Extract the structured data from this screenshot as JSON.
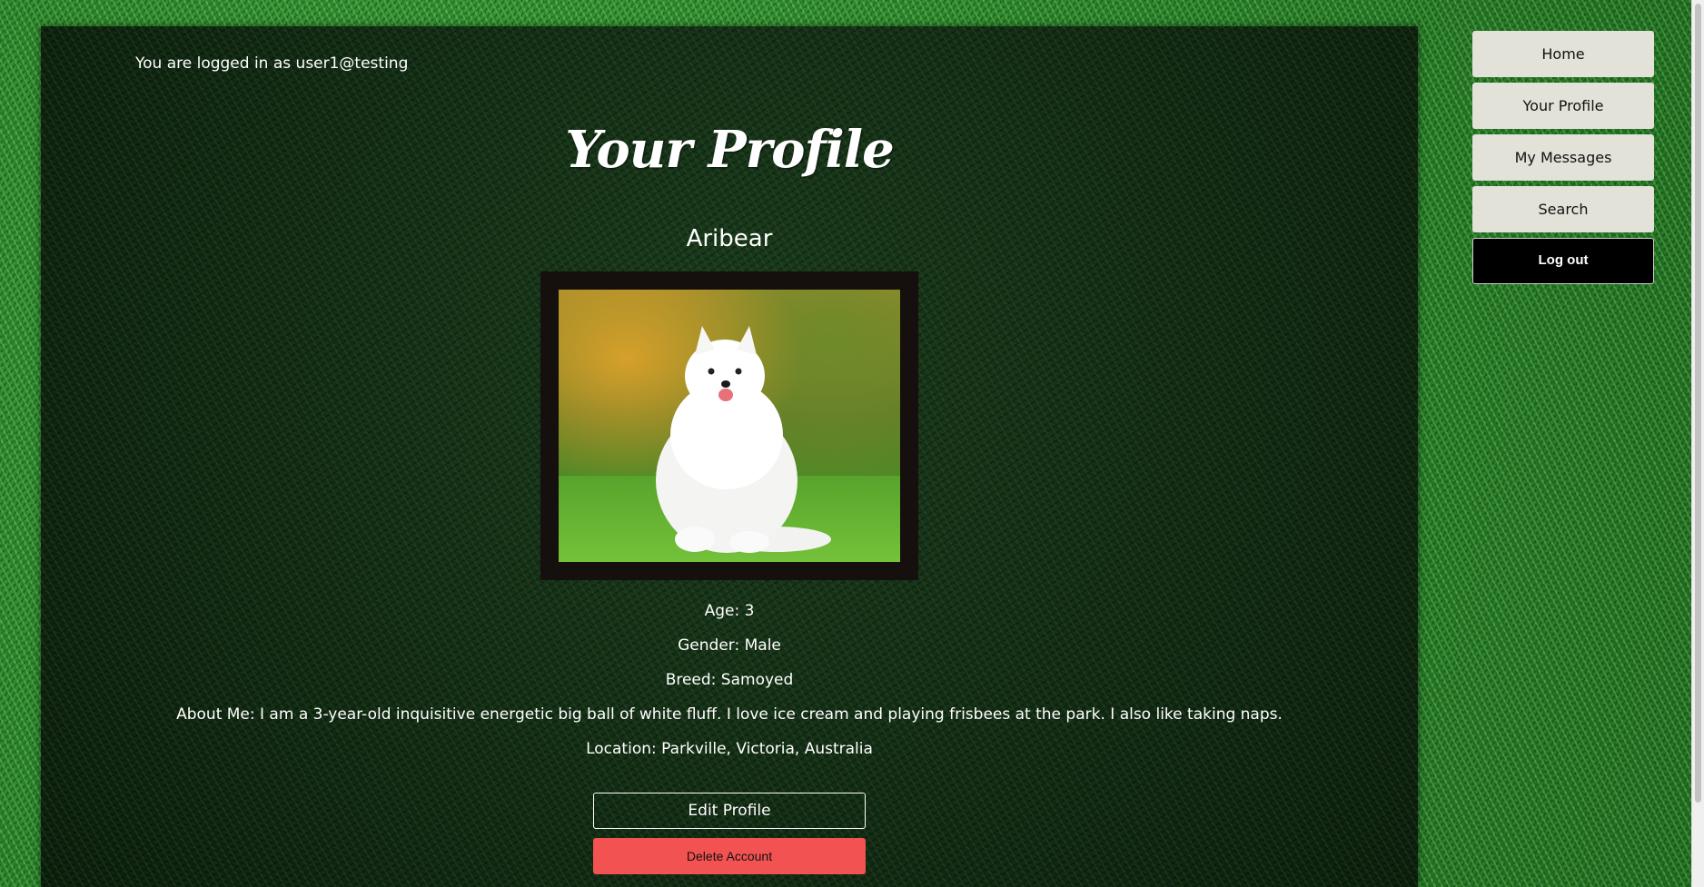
{
  "session": {
    "logged_in_text": "You are logged in as user1@testing"
  },
  "profile": {
    "title": "Your Profile",
    "name": "Aribear",
    "photo_alt": "Aribear",
    "age_line": "Age: 3",
    "gender_line": "Gender: Male",
    "breed_line": "Breed: Samoyed",
    "about_line": "About Me: I am a 3-year-old inquisitive energetic big ball of white fluff. I love ice cream and playing frisbees at the park. I also like taking naps.",
    "location_line": "Location: Parkville, Victoria, Australia"
  },
  "actions": {
    "edit_label": "Edit Profile",
    "delete_label": "Delete Account"
  },
  "nav": {
    "items": [
      {
        "label": "Home"
      },
      {
        "label": "Your Profile"
      },
      {
        "label": "My Messages"
      },
      {
        "label": "Search"
      },
      {
        "label": "Log out"
      }
    ]
  },
  "colors": {
    "delete_button": "#f25252",
    "nav_button": "#e2e2d8",
    "logout_button": "#000000",
    "panel": "#0f2411"
  }
}
